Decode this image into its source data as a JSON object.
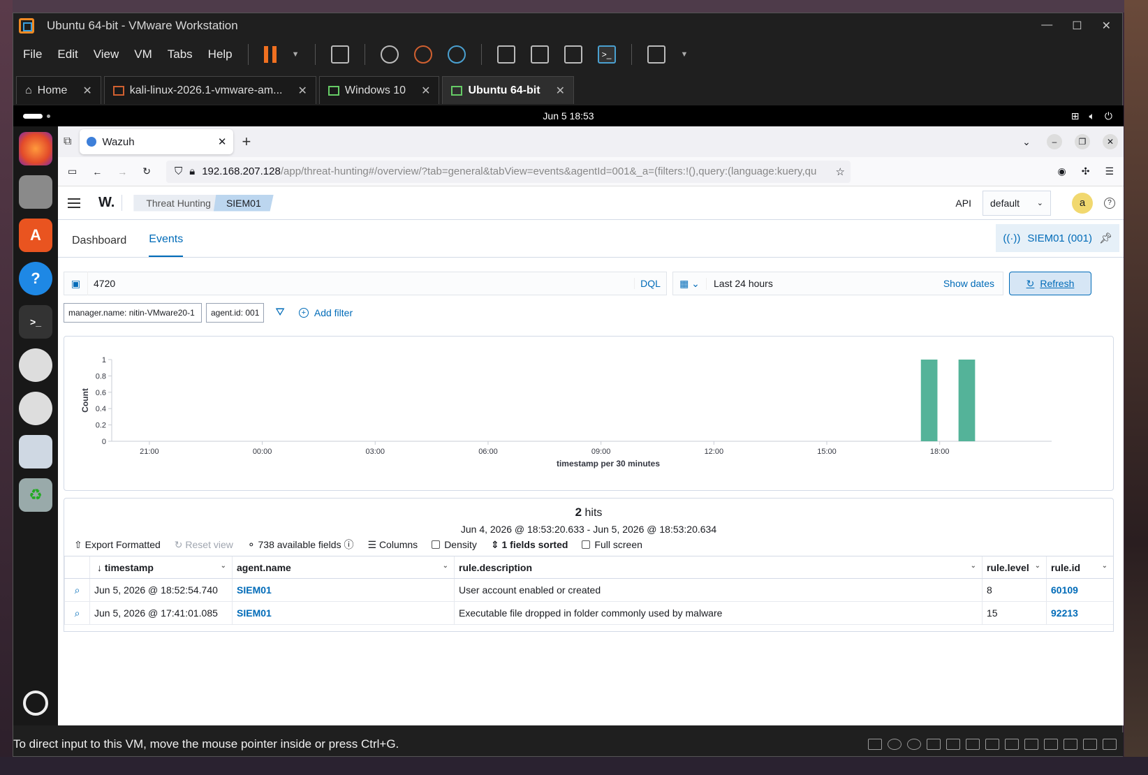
{
  "window": {
    "title": "Ubuntu 64-bit - VMware Workstation",
    "menu": [
      "File",
      "Edit",
      "View",
      "VM",
      "Tabs",
      "Help"
    ],
    "tabs": [
      {
        "label": "Home"
      },
      {
        "label": "kali-linux-2026.1-vmware-am..."
      },
      {
        "label": "Windows 10"
      },
      {
        "label": "Ubuntu 64-bit"
      }
    ],
    "status_text": "To direct input to this VM, move the mouse pointer inside or press Ctrl+G."
  },
  "gnome": {
    "clock": "Jun 5  18:53"
  },
  "browser": {
    "tab_title": "Wazuh",
    "url_host": "192.168.207.128",
    "url_path": "/app/threat-hunting#/overview/?tab=general&tabView=events&agentId=001&_a=(filters:!(),query:(language:kuery,qu"
  },
  "wazuh": {
    "logo": "W.",
    "breadcrumbs": [
      "Threat Hunting",
      "SIEM01"
    ],
    "api_label": "API",
    "api_select": "default",
    "avatar_letter": "a",
    "tabs": [
      "Dashboard",
      "Events"
    ],
    "pinned_agent": "SIEM01 (001)",
    "query": "4720",
    "query_language": "DQL",
    "time_range": "Last 24 hours",
    "show_dates": "Show dates",
    "refresh": "Refresh",
    "filters": [
      "manager.name: nitin-VMware20-1",
      "agent.id: 001"
    ],
    "add_filter": "Add filter",
    "hits_count": "2",
    "hits_label": "hits",
    "hits_range": "Jun 4, 2026 @ 18:53:20.633 - Jun 5, 2026 @ 18:53:20.634",
    "tools": {
      "export": "Export Formatted",
      "reset": "Reset view",
      "fields": "738 available fields",
      "columns": "Columns",
      "density": "Density",
      "sorted": "1 fields sorted",
      "fullscreen": "Full screen"
    },
    "table": {
      "columns": [
        "timestamp",
        "agent.name",
        "rule.description",
        "rule.level",
        "rule.id"
      ],
      "rows": [
        [
          "Jun 5, 2026 @ 18:52:54.740",
          "SIEM01",
          "User account enabled or created",
          "8",
          "60109"
        ],
        [
          "Jun 5, 2026 @ 17:41:01.085",
          "SIEM01",
          "Executable file dropped in folder commonly used by malware",
          "15",
          "92213"
        ]
      ]
    }
  },
  "chart_data": {
    "type": "bar",
    "xlabel": "timestamp per 30 minutes",
    "ylabel": "Count",
    "ylim": [
      0,
      1
    ],
    "yticks": [
      "0",
      "0.2",
      "0.4",
      "0.6",
      "0.8",
      "1"
    ],
    "xticks": [
      "21:00",
      "00:00",
      "03:00",
      "06:00",
      "09:00",
      "12:00",
      "15:00",
      "18:00"
    ],
    "x_range_hours": [
      -1,
      23.9
    ],
    "bars": [
      {
        "x": "17:30",
        "value": 1
      },
      {
        "x": "18:30",
        "value": 1
      }
    ],
    "color": "#54b399"
  }
}
